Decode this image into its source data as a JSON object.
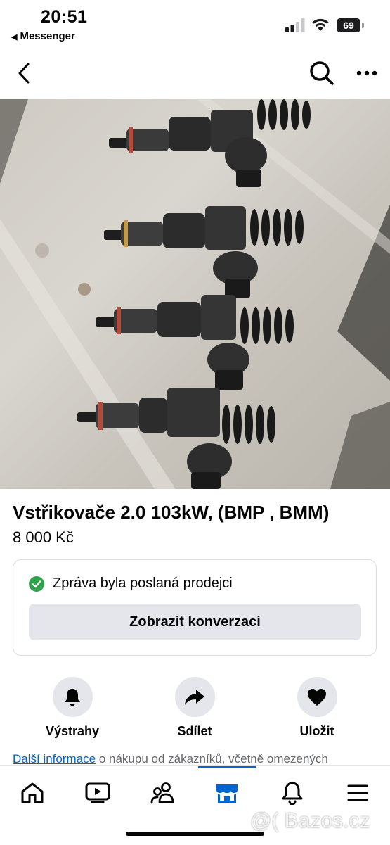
{
  "status_bar": {
    "time": "20:51",
    "back_app": "Messenger",
    "battery": "69"
  },
  "nav": {
    "icons": [
      "back-chevron-icon",
      "search-icon",
      "more-icon"
    ]
  },
  "listing": {
    "title": "Vstřikovače 2.0 103kW, (BMP , BMM)",
    "price": "8 000 Kč"
  },
  "message_card": {
    "status": "Zpráva byla poslaná prodejci",
    "button_label": "Zobrazit konverzaci",
    "status_color": "#31a24c"
  },
  "actions": [
    {
      "label": "Výstrahy",
      "icon": "bell-icon"
    },
    {
      "label": "Sdílet",
      "icon": "share-icon"
    },
    {
      "label": "Uložit",
      "icon": "heart-icon"
    }
  ],
  "more_info": {
    "link": "Další informace",
    "text": " o nákupu od zákazníků, včetně omezených"
  },
  "tabbar": {
    "items": [
      "home-icon",
      "video-icon",
      "friends-icon",
      "marketplace-icon",
      "notifications-icon",
      "menu-icon"
    ],
    "active": "marketplace-icon",
    "accent": "#0064d1"
  },
  "watermark": "@( Bazos.cz"
}
